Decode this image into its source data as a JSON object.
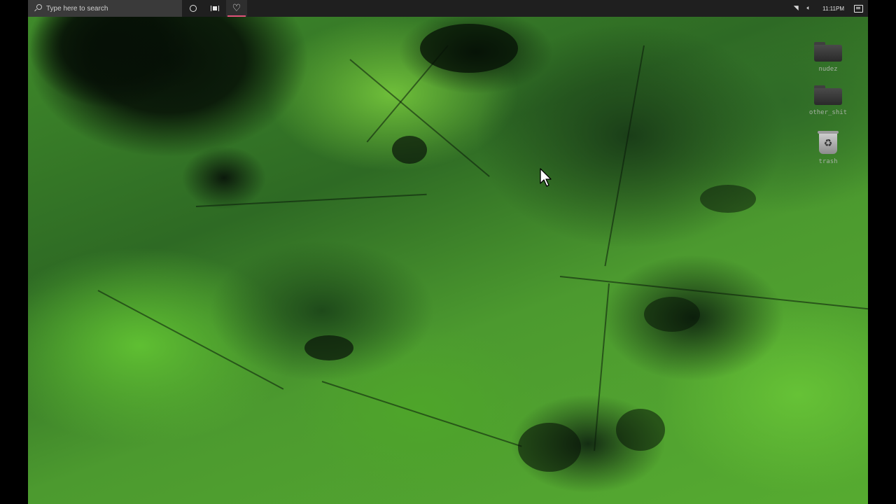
{
  "taskbar": {
    "search_placeholder": "Type here to search",
    "buttons": [
      {
        "icon": "cortana-icon"
      },
      {
        "icon": "task-view-icon"
      },
      {
        "icon": "heart-app-icon",
        "active": true
      }
    ],
    "tray": {
      "icons": [
        "network-icon",
        "volume-icon"
      ],
      "clock": "11:11PM",
      "notification_icon": "action-center-icon"
    },
    "accent_color": "#e2527a"
  },
  "desktop": {
    "wallpaper": "green satellite terrain",
    "icons": [
      {
        "label": "nudez",
        "icon": "folder-icon"
      },
      {
        "label": "other_shit",
        "icon": "folder-icon"
      },
      {
        "label": "trash",
        "icon": "recycle-bin-icon"
      }
    ]
  },
  "cursor": {
    "icon": "arrow-cursor-icon"
  }
}
